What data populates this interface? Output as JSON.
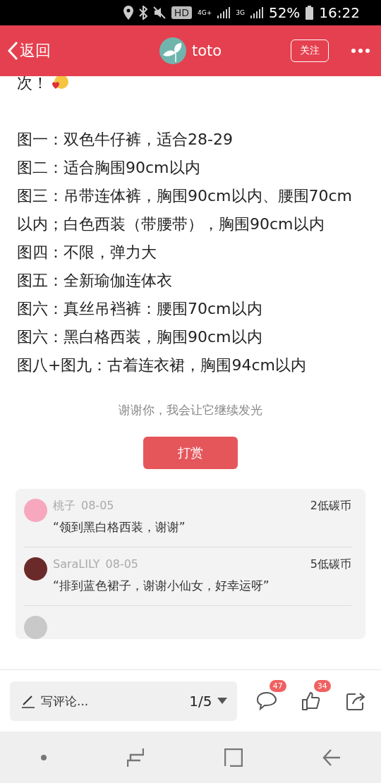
{
  "status_bar": {
    "battery": "52%",
    "time": "16:22",
    "hd": "HD",
    "network_4g": "4G+",
    "network_3g": "3G"
  },
  "header": {
    "back": "返回",
    "title": "toto",
    "follow": "关注"
  },
  "post": {
    "lead": "次！",
    "lines": [
      "图一：双色牛仔裤，适合28-29",
      "图二：适合胸围90cm以内",
      "图三：吊带连体裤，胸围90cm以内、腰围70cm以内；白色西装（带腰带），胸围90cm以内",
      "图四：不限，弹力大",
      "图五：全新瑜伽连体衣",
      "图六：真丝吊裆裤：腰围70cm以内",
      "图六：黑白格西装，胸围90cm以内",
      "图八+图九：古着连衣裙，胸围94cm以内"
    ],
    "thanks": "谢谢你，我会让它继续发光",
    "reward_button": "打赏"
  },
  "rewards": [
    {
      "name": "桃子",
      "date": "08-05",
      "amount": "2低碳币",
      "message": "“领到黑白格西装，谢谢”",
      "color": "#f7a8be"
    },
    {
      "name": "SaraLILY",
      "date": "08-05",
      "amount": "5低碳币",
      "message": "“排到蓝色裙子，谢谢小仙女，好幸运呀”",
      "color": "#6b2a2a"
    }
  ],
  "bottom_bar": {
    "placeholder": "写评论...",
    "page": "1/5",
    "comments_count": "47",
    "likes_count": "34"
  }
}
